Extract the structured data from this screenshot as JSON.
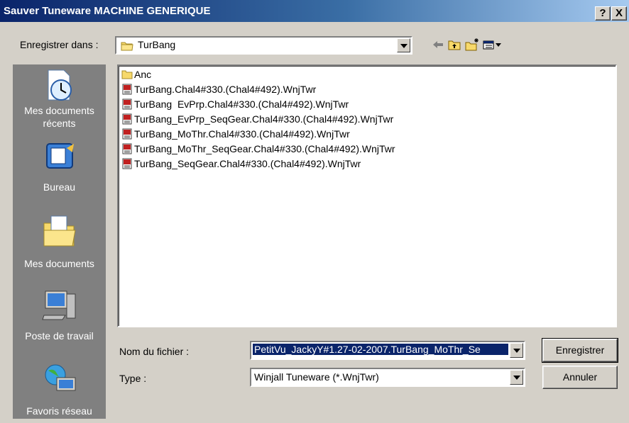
{
  "window": {
    "title": "Sauver Tuneware MACHINE GENERIQUE",
    "help_label": "?",
    "close_label": "X"
  },
  "lookin": {
    "label": "Enregistrer dans :",
    "value": "TurBang"
  },
  "places": [
    {
      "label": "Mes documents récents",
      "icon": "recent-documents-icon"
    },
    {
      "label": "Bureau",
      "icon": "desktop-icon"
    },
    {
      "label": "Mes documents",
      "icon": "my-documents-icon"
    },
    {
      "label": "Poste de travail",
      "icon": "my-computer-icon"
    },
    {
      "label": "Favoris réseau",
      "icon": "network-places-icon"
    }
  ],
  "files": [
    {
      "name": "Anc",
      "type": "folder"
    },
    {
      "name": "TurBang.Chal4#330.(Chal4#492).WnjTwr",
      "type": "tuneware"
    },
    {
      "name": "TurBang  EvPrp.Chal4#330.(Chal4#492).WnjTwr",
      "type": "tuneware"
    },
    {
      "name": "TurBang_EvPrp_SeqGear.Chal4#330.(Chal4#492).WnjTwr",
      "type": "tuneware"
    },
    {
      "name": "TurBang_MoThr.Chal4#330.(Chal4#492).WnjTwr",
      "type": "tuneware"
    },
    {
      "name": "TurBang_MoThr_SeqGear.Chal4#330.(Chal4#492).WnjTwr",
      "type": "tuneware"
    },
    {
      "name": "TurBang_SeqGear.Chal4#330.(Chal4#492).WnjTwr",
      "type": "tuneware"
    }
  ],
  "filename": {
    "label": "Nom du fichier :",
    "value": "PetitVu_JackyY#1.27-02-2007.TurBang_MoThr_Se"
  },
  "filetype": {
    "label": "Type :",
    "value": "Winjall Tuneware (*.WnjTwr)"
  },
  "buttons": {
    "save": "Enregistrer",
    "cancel": "Annuler"
  },
  "colors": {
    "title_bar": "#0a246a",
    "places_bar": "#808080",
    "dialog": "#d4d0c8"
  }
}
